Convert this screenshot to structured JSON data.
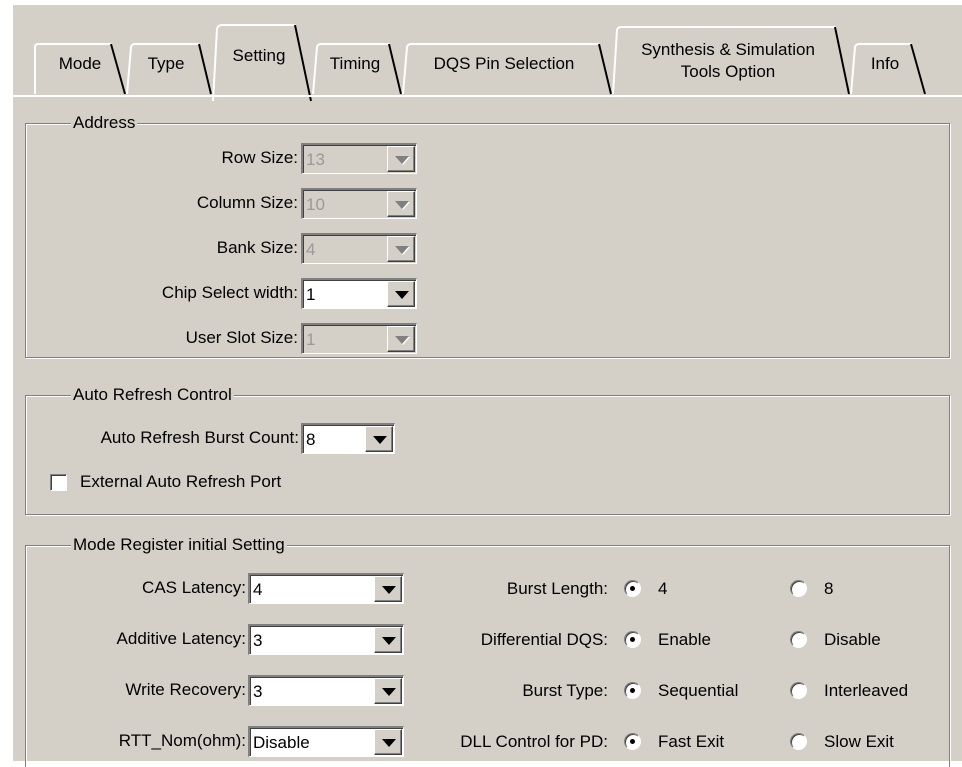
{
  "tabs": [
    {
      "label": "Mode",
      "active": false
    },
    {
      "label": "Type",
      "active": false
    },
    {
      "label": "Setting",
      "active": true
    },
    {
      "label": "Timing",
      "active": false
    },
    {
      "label": "DQS Pin Selection",
      "active": false
    },
    {
      "label_line1": "Synthesis & Simulation",
      "label_line2": "Tools Option",
      "active": false
    },
    {
      "label": "Info",
      "active": false
    }
  ],
  "address": {
    "title": "Address",
    "row_size": {
      "label": "Row Size:",
      "value": "13",
      "enabled": false
    },
    "column_size": {
      "label": "Column Size:",
      "value": "10",
      "enabled": false
    },
    "bank_size": {
      "label": "Bank Size:",
      "value": "4",
      "enabled": false
    },
    "chip_select_width": {
      "label": "Chip Select width:",
      "value": "1",
      "enabled": true
    },
    "user_slot_size": {
      "label": "User Slot Size:",
      "value": "1",
      "enabled": false
    }
  },
  "auto_refresh": {
    "title": "Auto Refresh Control",
    "burst_count": {
      "label": "Auto Refresh Burst Count:",
      "value": "8"
    },
    "external_port": {
      "label": "External Auto Refresh Port",
      "checked": false
    }
  },
  "mode_register": {
    "title": "Mode Register initial Setting",
    "cas_latency": {
      "label": "CAS Latency:",
      "value": "4"
    },
    "additive_latency": {
      "label": "Additive Latency:",
      "value": "3"
    },
    "write_recovery": {
      "label": "Write Recovery:",
      "value": "3"
    },
    "rtt_nom": {
      "label": "RTT_Nom(ohm):",
      "value": "Disable"
    },
    "burst_length": {
      "label": "Burst Length:",
      "option1": "4",
      "option2": "8",
      "selected": "4"
    },
    "differential_dqs": {
      "label": "Differential DQS:",
      "option1": "Enable",
      "option2": "Disable",
      "selected": "Enable"
    },
    "burst_type": {
      "label": "Burst Type:",
      "option1": "Sequential",
      "option2": "Interleaved",
      "selected": "Sequential"
    },
    "dll_control": {
      "label": "DLL Control for PD:",
      "option1": "Fast Exit",
      "option2": "Slow Exit",
      "selected": "Fast Exit"
    }
  },
  "colors": {
    "face": "#d4d0c8",
    "shadow": "#808080",
    "highlight": "#ffffff",
    "disabled_text": "#9a9a9a"
  }
}
